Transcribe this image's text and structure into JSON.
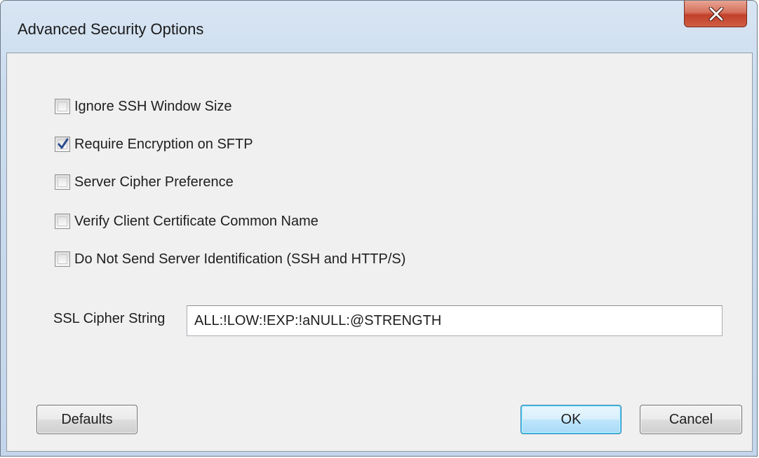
{
  "window": {
    "title": "Advanced Security Options",
    "close_icon": "close-x-icon"
  },
  "options": [
    {
      "label": "Ignore SSH Window Size",
      "checked": false
    },
    {
      "label": "Require Encryption on SFTP",
      "checked": true
    },
    {
      "label": "Server Cipher Preference",
      "checked": false
    },
    {
      "label": "Verify Client Certificate Common Name",
      "checked": false
    },
    {
      "label": "Do Not Send Server Identification (SSH and HTTP/S)",
      "checked": false
    }
  ],
  "cipher": {
    "label": "SSL Cipher String",
    "value": "ALL:!LOW:!EXP:!aNULL:@STRENGTH"
  },
  "buttons": {
    "defaults": "Defaults",
    "ok": "OK",
    "cancel": "Cancel"
  },
  "colors": {
    "close_button": "#c7432c",
    "checkmark": "#2a4d8f",
    "default_button_border": "#3c7fb1"
  }
}
